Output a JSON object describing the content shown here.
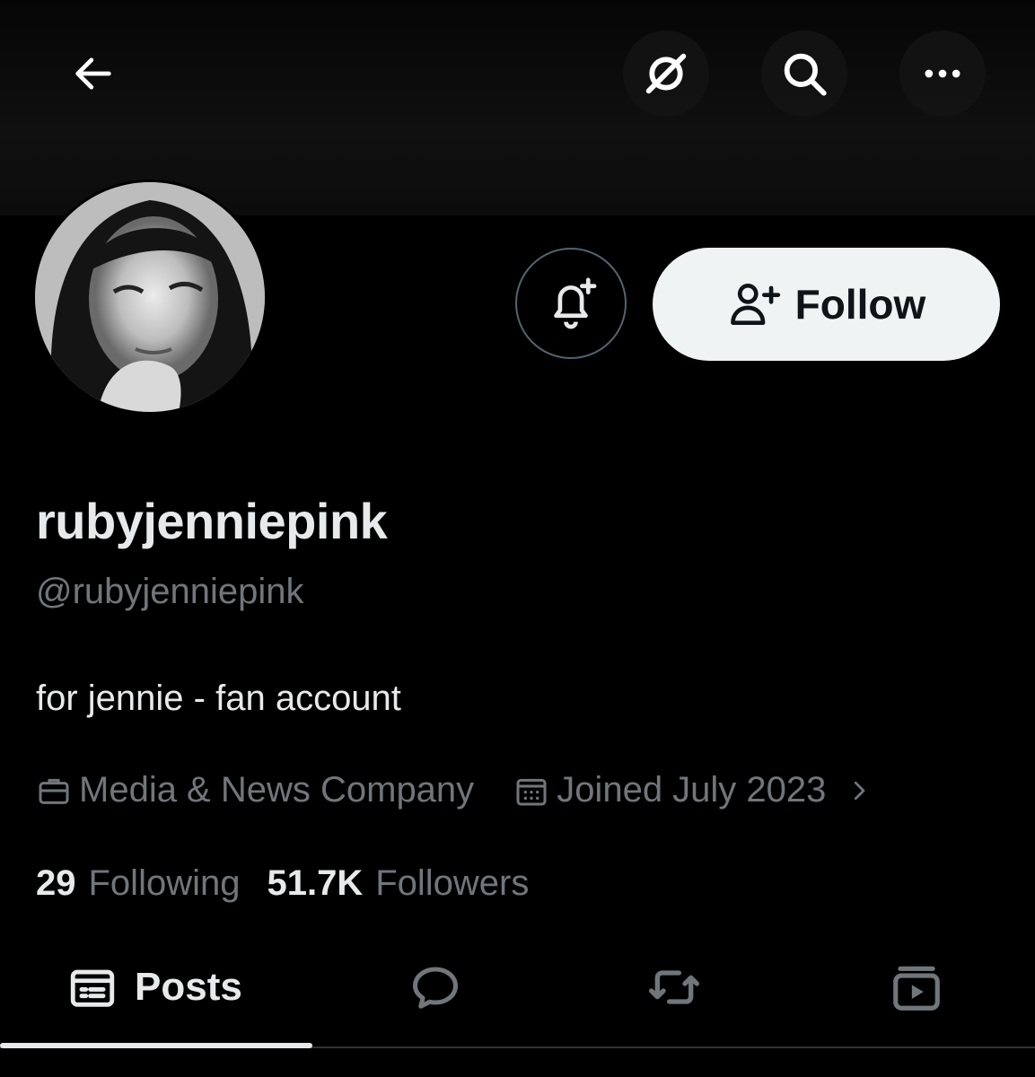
{
  "header": {
    "back_icon": "arrow-left-icon",
    "grok_icon": "grok-icon",
    "search_icon": "search-icon",
    "more_icon": "more-horizontal-icon"
  },
  "profile": {
    "display_name": "rubyjenniepink",
    "handle": "@rubyjenniepink",
    "bio": "for jennie - fan account",
    "category": "Media & News Company",
    "joined": "Joined July 2023",
    "following_count": "29",
    "following_label": "Following",
    "followers_count": "51.7K",
    "followers_label": "Followers"
  },
  "actions": {
    "notify_icon": "bell-plus-icon",
    "follow_label": "Follow",
    "follow_icon": "person-plus-icon"
  },
  "tabs": [
    {
      "label": "Posts",
      "icon": "posts-icon",
      "active": true
    },
    {
      "label": "",
      "icon": "reply-bubble-icon",
      "active": false
    },
    {
      "label": "",
      "icon": "repost-icon",
      "active": false
    },
    {
      "label": "",
      "icon": "media-video-icon",
      "active": false
    }
  ],
  "colors": {
    "background": "#000000",
    "text_primary": "#e7e9ea",
    "text_secondary": "#71767b",
    "follow_bg": "#eff3f4",
    "border": "#536471"
  }
}
